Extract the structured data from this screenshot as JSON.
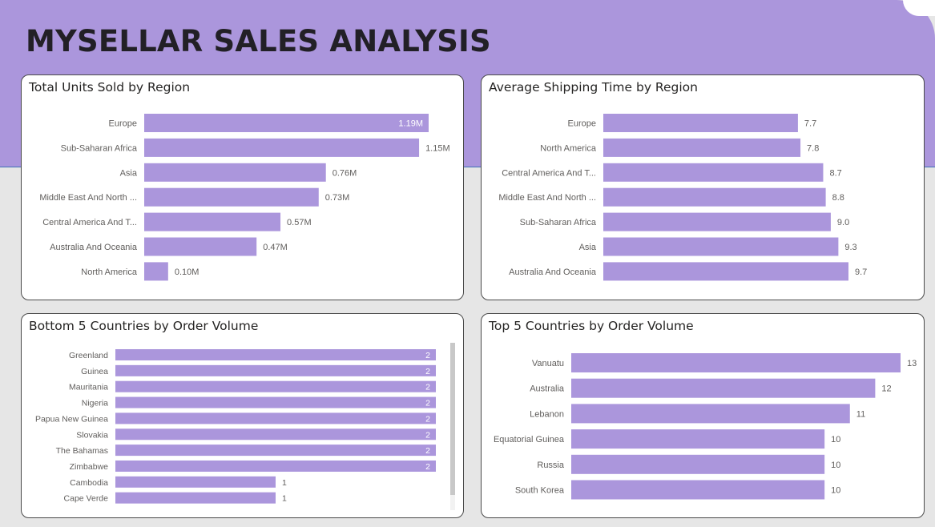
{
  "title": "MYSELLAR SALES ANALYSIS",
  "colors": {
    "banner": "#ab96dc",
    "bar": "#ab96dc",
    "background": "#e6e6e6",
    "label": "#605e5c",
    "data_label_inside": "#ffffff"
  },
  "chart_data": [
    {
      "type": "bar",
      "orientation": "horizontal",
      "title": "Total Units Sold by Region",
      "categories": [
        "Europe",
        "Sub-Saharan Africa",
        "Asia",
        "Middle East And North ...",
        "Central America And T...",
        "Australia And Oceania",
        "North America"
      ],
      "values": [
        1.19,
        1.15,
        0.76,
        0.73,
        0.57,
        0.47,
        0.1
      ],
      "value_labels": [
        "1.19M",
        "1.15M",
        "0.76M",
        "0.73M",
        "0.57M",
        "0.47M",
        "0.10M"
      ],
      "unit": "M",
      "xlim": [
        0,
        1.19
      ]
    },
    {
      "type": "bar",
      "orientation": "horizontal",
      "title": "Average Shipping Time by Region",
      "categories": [
        "Europe",
        "North America",
        "Central America And T...",
        "Middle East And North ...",
        "Sub-Saharan Africa",
        "Asia",
        "Australia And Oceania"
      ],
      "values": [
        7.7,
        7.8,
        8.7,
        8.8,
        9.0,
        9.3,
        9.7
      ],
      "value_labels": [
        "7.7",
        "7.8",
        "8.7",
        "8.8",
        "9.0",
        "9.3",
        "9.7"
      ],
      "xlim": [
        0,
        9.7
      ]
    },
    {
      "type": "bar",
      "orientation": "horizontal",
      "title": "Bottom 5 Countries by Order Volume",
      "categories": [
        "Greenland",
        "Guinea",
        "Mauritania",
        "Nigeria",
        "Papua New Guinea",
        "Slovakia",
        "The Bahamas",
        "Zimbabwe",
        "Cambodia",
        "Cape Verde"
      ],
      "values": [
        2,
        2,
        2,
        2,
        2,
        2,
        2,
        2,
        1,
        1
      ],
      "value_labels": [
        "2",
        "2",
        "2",
        "2",
        "2",
        "2",
        "2",
        "2",
        "1",
        "1"
      ],
      "xlim": [
        0,
        2
      ],
      "scrollable": true
    },
    {
      "type": "bar",
      "orientation": "horizontal",
      "title": "Top 5 Countries by Order Volume",
      "categories": [
        "Vanuatu",
        "Australia",
        "Lebanon",
        "Equatorial Guinea",
        "Russia",
        "South Korea"
      ],
      "values": [
        13,
        12,
        11,
        10,
        10,
        10
      ],
      "value_labels": [
        "13",
        "12",
        "11",
        "10",
        "10",
        "10"
      ],
      "xlim": [
        0,
        13
      ]
    }
  ]
}
